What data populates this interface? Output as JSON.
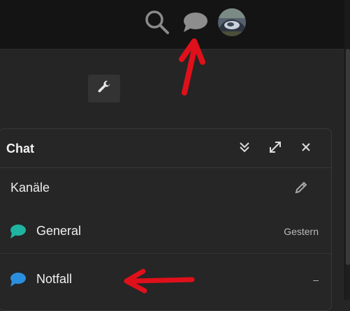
{
  "topbar": {
    "icons": [
      "search-icon",
      "chat-bubble-icon",
      "avatar"
    ]
  },
  "toolbar": {
    "wrench_icon": "wrench-icon"
  },
  "chat": {
    "title": "Chat",
    "header_buttons": [
      "collapse-icon",
      "expand-icon",
      "close-icon"
    ],
    "section_title": "Kanäle",
    "channels": [
      {
        "name": "General",
        "time": "Gestern",
        "color": "#1fb3a2"
      },
      {
        "name": "Notfall",
        "time": "–",
        "color": "#2b8fe0"
      }
    ]
  },
  "colors": {
    "annotation_arrow": "#e0101a",
    "background": "#252525",
    "topbar": "#141414"
  }
}
